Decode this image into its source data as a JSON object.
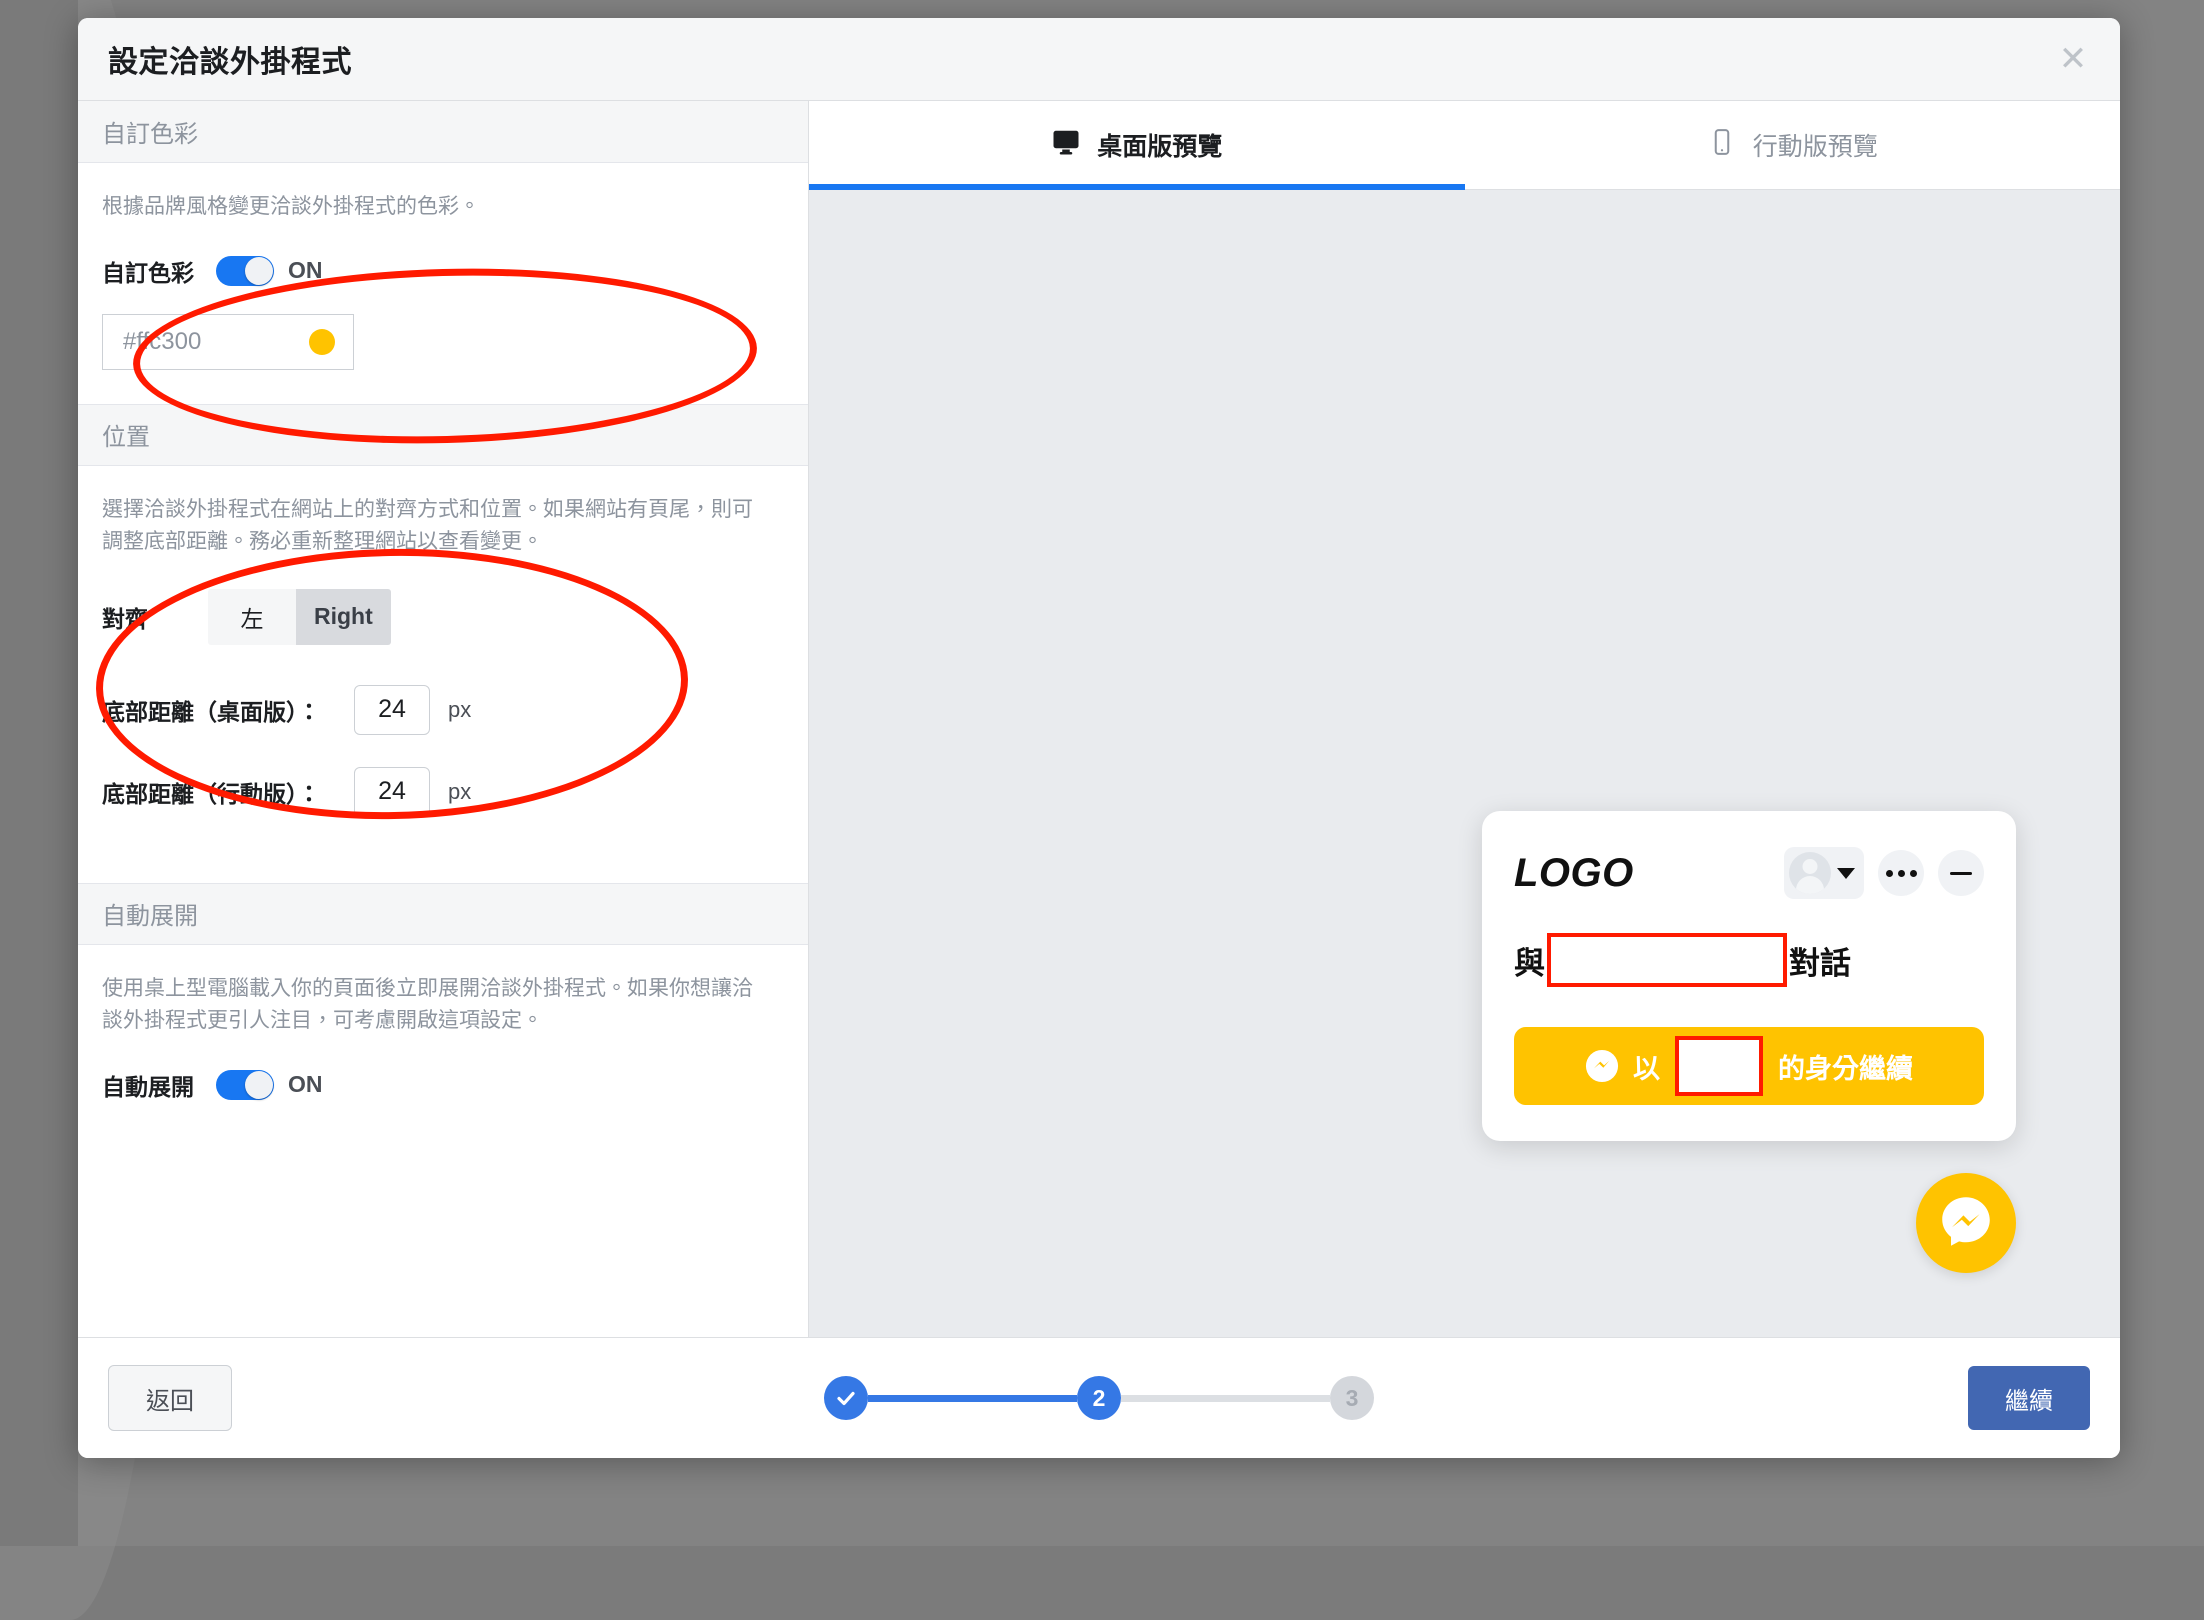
{
  "modal": {
    "title": "設定洽談外掛程式",
    "close_icon": "close-icon"
  },
  "settings": {
    "custom_color": {
      "section_title": "自訂色彩",
      "description": "根據品牌風格變更洽談外掛程式的色彩。",
      "toggle_label": "自訂色彩",
      "toggle_state": "ON",
      "color_value": "#ffc300",
      "color_hex": "#ffc300"
    },
    "position": {
      "section_title": "位置",
      "description": "選擇洽談外掛程式在網站上的對齊方式和位置。如果網站有頁尾，則可調整底部距離。務必重新整理網站以查看變更。",
      "align_label": "對齊",
      "align_options": [
        "左",
        "Right"
      ],
      "align_selected": "Right",
      "desktop_spacing_label": "底部距離（桌面版）：",
      "desktop_spacing_value": "24",
      "desktop_spacing_unit": "px",
      "mobile_spacing_label": "底部距離（行動版）：",
      "mobile_spacing_value": "24",
      "mobile_spacing_unit": "px"
    },
    "auto_expand": {
      "section_title": "自動展開",
      "description": "使用桌上型電腦載入你的頁面後立即展開洽談外掛程式。如果你想讓洽談外掛程式更引人注目，可考慮開啟這項設定。",
      "toggle_label": "自動展開",
      "toggle_state": "ON"
    }
  },
  "preview": {
    "tabs": [
      {
        "label": "桌面版預覽",
        "icon": "monitor-icon",
        "active": true
      },
      {
        "label": "行動版預覽",
        "icon": "mobile-icon",
        "active": false
      }
    ],
    "widget": {
      "logo_text": "LOGO",
      "avatar_icon": "avatar-icon",
      "caret_icon": "chevron-down-icon",
      "more_icon": "more-options-icon",
      "minimize_icon": "minimize-icon",
      "greeting_prefix": "與",
      "greeting_suffix": "對話",
      "cta_prefix": "以",
      "cta_suffix": "的身分繼續",
      "cta_icon": "messenger-icon",
      "cta_color": "#ffc300"
    },
    "launcher": {
      "icon": "messenger-icon",
      "color": "#ffc300"
    }
  },
  "footer": {
    "back_label": "返回",
    "continue_label": "繼續",
    "steps": [
      {
        "label": "",
        "state": "done",
        "icon": "check-icon"
      },
      {
        "label": "2",
        "state": "current"
      },
      {
        "label": "3",
        "state": "todo"
      }
    ]
  },
  "theme": {
    "accent_blue": "#1877f2",
    "primary_button": "#4267b2",
    "brand_yellow": "#ffc300",
    "annotation_red": "#ff1a00"
  }
}
